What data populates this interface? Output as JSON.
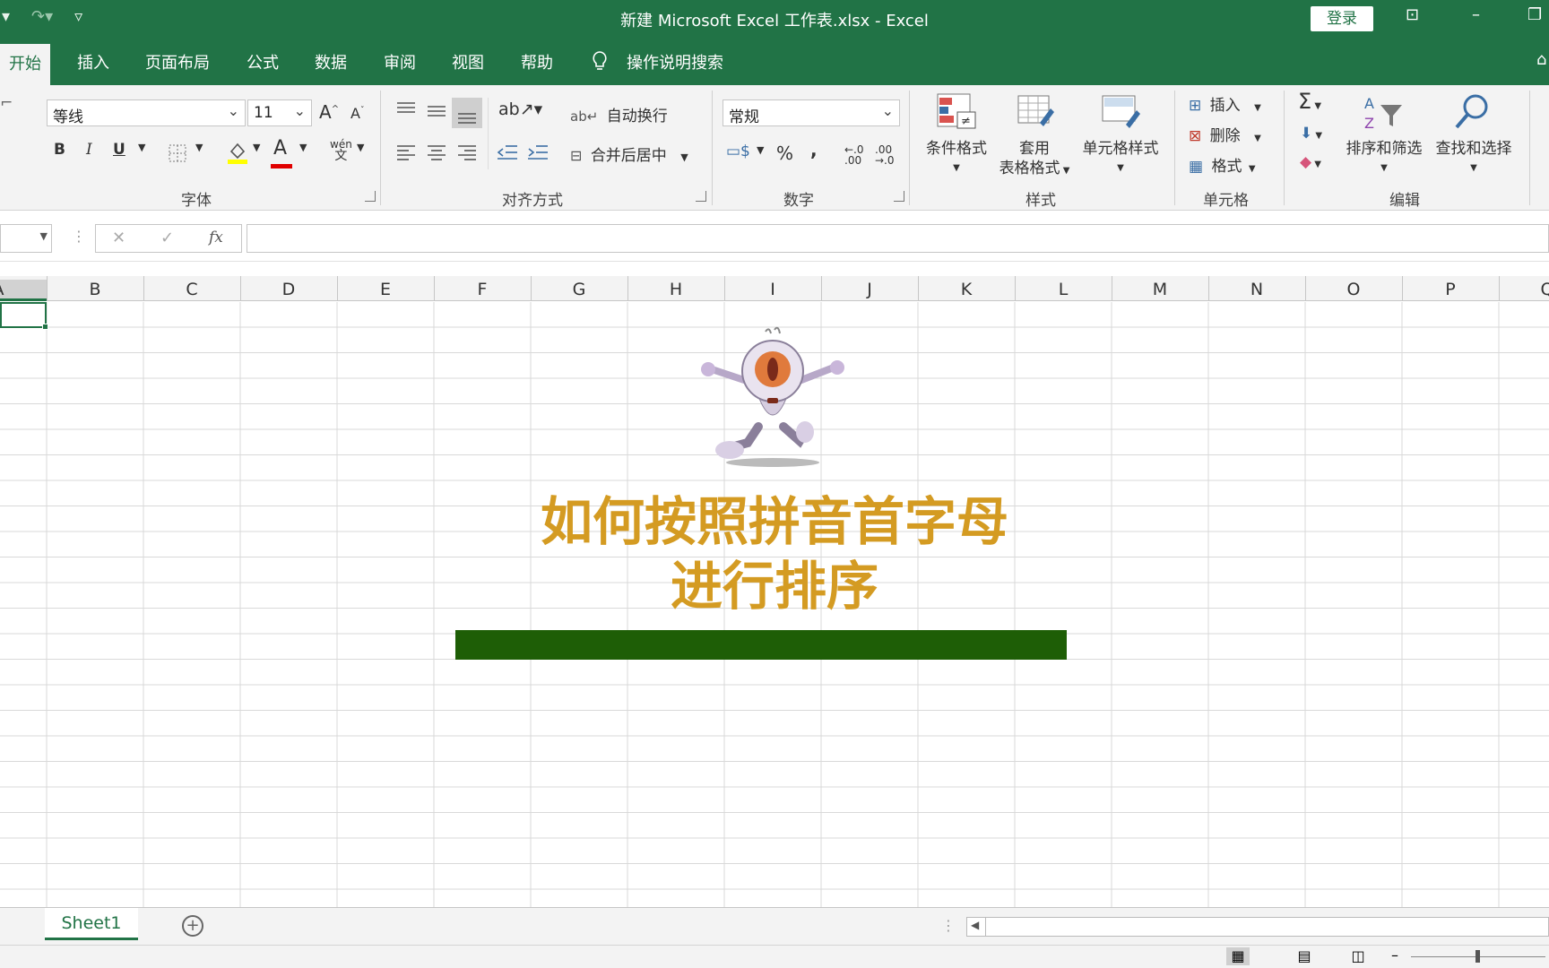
{
  "window": {
    "title": "新建 Microsoft Excel 工作表.xlsx  -  Excel",
    "login_label": "登录",
    "qat": {
      "undo": "▾",
      "redo": "↷▾",
      "customize": "▿"
    },
    "controls": {
      "ribbon_display": "⊡",
      "minimize": "–",
      "restore": "❐"
    }
  },
  "tabs": {
    "home": "开始",
    "insert": "插入",
    "page_layout": "页面布局",
    "formulas": "公式",
    "data": "数据",
    "review": "审阅",
    "view": "视图",
    "help": "帮助",
    "tell_me": "操作说明搜索"
  },
  "ribbon": {
    "font": {
      "group_label": "字体",
      "font_name": "等线",
      "font_size": "11",
      "bold": "B",
      "italic": "I",
      "underline": "U",
      "grow": "A",
      "shrink": "A",
      "color_letter": "A",
      "phonetic": "wén"
    },
    "alignment": {
      "group_label": "对齐方式",
      "wrap_text": "自动换行",
      "merge_center": "合并后居中"
    },
    "number": {
      "group_label": "数字",
      "format": "常规",
      "percent": "%",
      "comma": ","
    },
    "styles": {
      "group_label": "样式",
      "conditional": "条件格式",
      "table_line1": "套用",
      "table_line2": "表格格式",
      "cell_styles": "单元格样式"
    },
    "cells": {
      "group_label": "单元格",
      "insert": "插入",
      "delete": "删除",
      "format": "格式"
    },
    "editing": {
      "group_label": "编辑",
      "sort_filter": "排序和筛选",
      "find_select": "查找和选择",
      "sum": "Σ"
    }
  },
  "formula_bar": {
    "cancel": "✕",
    "enter": "✓",
    "fx": "fx",
    "value": ""
  },
  "columns": [
    "A",
    "B",
    "C",
    "D",
    "E",
    "F",
    "G",
    "H",
    "I",
    "J",
    "K",
    "L",
    "M",
    "N",
    "O",
    "P",
    "Q"
  ],
  "banner": {
    "line1": "如何按照拼音首字母",
    "line2": "进行排序"
  },
  "sheets": {
    "active": "Sheet1",
    "add": "+"
  },
  "colors": {
    "excel_green": "#217346",
    "banner_text": "#d49b22",
    "banner_bar": "#1e5e06"
  }
}
